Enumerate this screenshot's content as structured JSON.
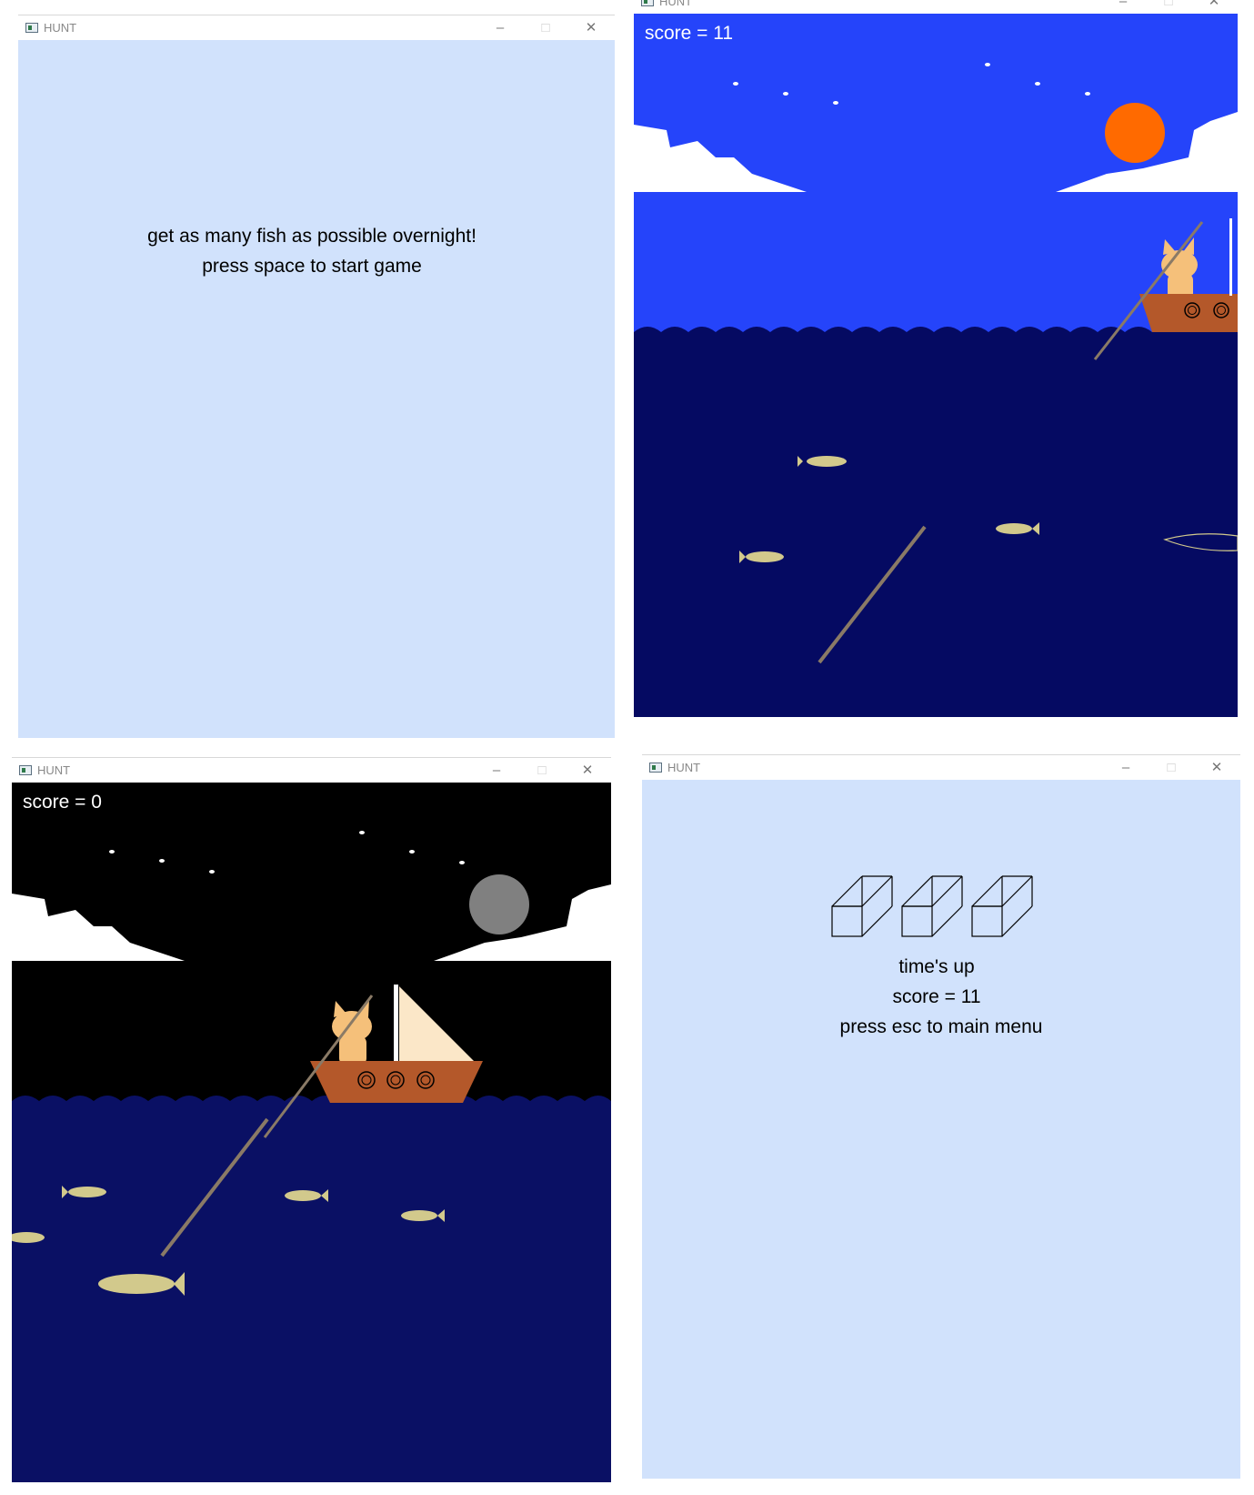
{
  "colors": {
    "menu_bg": "#d1e2fc",
    "day_sky": "#2544fa",
    "day_water": "#050a62",
    "night_sky": "#000000",
    "night_water": "#0a1064",
    "cloud": "#ffffff",
    "sun": "#ff6a00",
    "moon": "#808080",
    "fish": "#d2c98c",
    "boat": "#b4582a",
    "cat": "#f5c07a",
    "sail": "#fbe7c8",
    "spear": "#8a7a66"
  },
  "window_title": "HUNT",
  "controls": {
    "minimize": "–",
    "maximize": "□",
    "close": "✕"
  },
  "start_screen": {
    "line1": "get as many fish as possible overnight!",
    "line2": "press space to start game"
  },
  "day_game": {
    "score": "score = 11"
  },
  "night_game": {
    "score": "score = 0"
  },
  "end_screen": {
    "line1": "time's up",
    "line2": "score = 11",
    "line3": "press esc to main menu"
  }
}
